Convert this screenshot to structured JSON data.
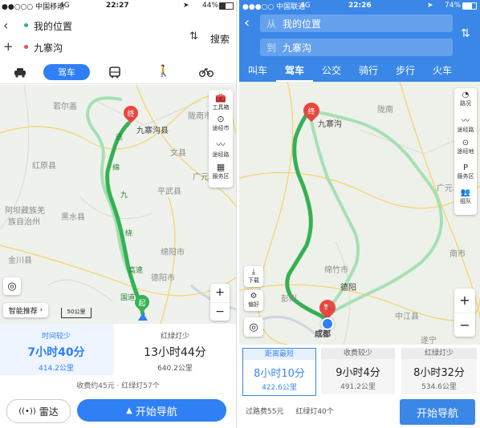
{
  "left": {
    "status": {
      "carrier": "●●○○○ 中国移动",
      "network": "4G",
      "time": "22:27",
      "battery": "44%"
    },
    "route_inputs": {
      "from": "我的位置",
      "to": "九寨沟",
      "search_label": "搜索"
    },
    "modes": {
      "active_label": "驾车"
    },
    "map": {
      "labels": {
        "ruoergai": "若尔盖",
        "hongyuan": "红原县",
        "aba": "阿坝藏族羌",
        "aba2": "族自治州",
        "heishui": "黑水县",
        "jinchuan": "金川县",
        "wenxian": "文县",
        "pingwu": "平武县",
        "guangyuan": "广元",
        "jiuzhaigou": "九寨沟县",
        "mianyang": "绵阳市",
        "deyang": "德阳市",
        "longnan": "陇南市"
      },
      "route_labels": {
        "r1": "迭",
        "r2": "绵",
        "r3": "九",
        "r4": "绕",
        "r5": "高速",
        "r6": "国道"
      },
      "end_marker": "终",
      "start_marker": "起",
      "scale": "50公里",
      "tools": [
        "工具箱",
        "途经市",
        "途经路",
        "服务区"
      ],
      "smart_recommend": "智能推荐"
    },
    "routes": [
      {
        "tag": "时间较少",
        "time": "7小时40分",
        "distance": "414.2公里"
      },
      {
        "tag": "红绿灯少",
        "time": "13小时44分",
        "distance": "640.2公里"
      }
    ],
    "footer_info": "收费约45元 · 红绿灯57个",
    "radar_label": "雷达",
    "start_nav_label": "开始导航"
  },
  "right": {
    "status": {
      "carrier": "●●●○○ 中国联通",
      "network": "4G",
      "time": "22:26",
      "battery": "74%"
    },
    "route_inputs": {
      "from_prefix": "从",
      "from": "我的位置",
      "to_prefix": "到",
      "to": "九寨沟"
    },
    "tabs": [
      "叫车",
      "驾车",
      "公交",
      "骑行",
      "步行",
      "火车"
    ],
    "active_tab": 1,
    "map": {
      "labels": {
        "longnan": "陇南",
        "jiuzhaigou": "九寨沟",
        "guangyuan": "广元",
        "mianzhu": "绵竹市",
        "deyang": "德阳",
        "chengdu": "成都",
        "suining": "遂宁",
        "zhongjiang": "中江县",
        "nanchong": "南市",
        "pengzhou": "彭州"
      },
      "end_marker": "终",
      "tools_top": [
        "路况",
        "途经路",
        "途经地",
        "服务区",
        "组队"
      ],
      "tools_left": [
        "下载",
        "偏好"
      ]
    },
    "routes": [
      {
        "tag": "距离最短",
        "time": "8小时10分",
        "distance": "422.6公里"
      },
      {
        "tag": "收费较少",
        "time": "9小时4分",
        "distance": "491.2公里"
      },
      {
        "tag": "红绿灯少",
        "time": "8小时32分",
        "distance": "534.6公里"
      }
    ],
    "footer": {
      "toll": "过路费55元",
      "lights": "红绿灯40个"
    },
    "start_nav_label": "开始导航"
  }
}
